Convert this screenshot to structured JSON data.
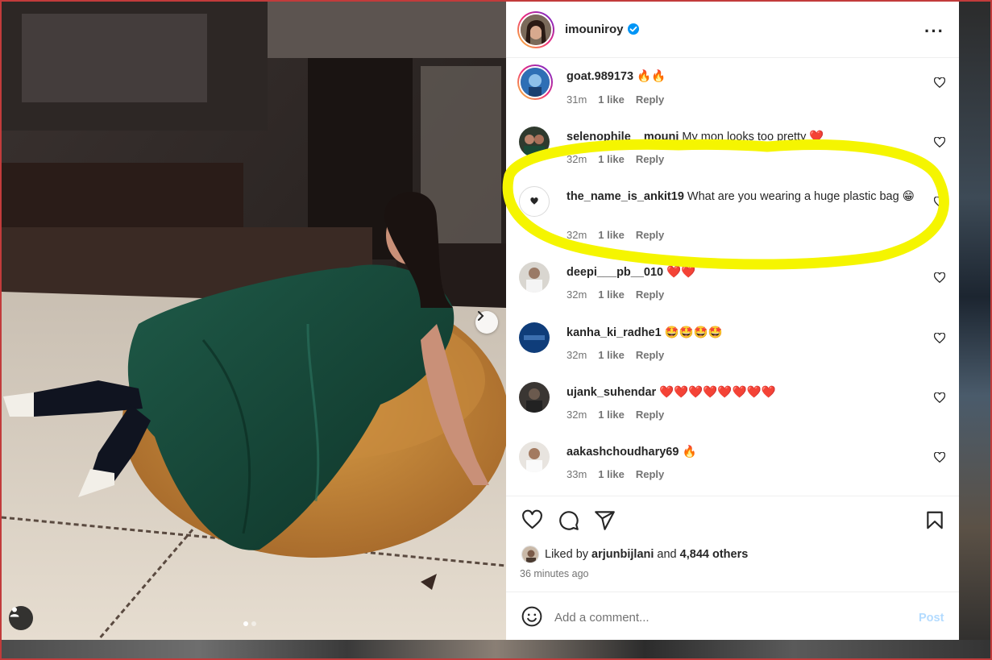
{
  "post": {
    "author": "imouniroy",
    "verified": true,
    "more_icon": "more-horizontal-icon"
  },
  "comments": [
    {
      "user": "goat.989173",
      "text": "🔥🔥",
      "time": "31m",
      "likes": "1 like",
      "reply": "Reply",
      "story_ring": true
    },
    {
      "user": "selenophile__mouni",
      "text": "My mon looks too pretty ❤️",
      "time": "32m",
      "likes": "1 like",
      "reply": "Reply",
      "story_ring": false
    },
    {
      "user": "the_name_is_ankit19",
      "text": "What are you wearing a huge plastic bag 😁",
      "time": "32m",
      "likes": "1 like",
      "reply": "Reply",
      "story_ring": false
    },
    {
      "user": "deepi___pb__010",
      "text": "❤️❤️",
      "time": "32m",
      "likes": "1 like",
      "reply": "Reply",
      "story_ring": false
    },
    {
      "user": "kanha_ki_radhe1",
      "text": "🤩🤩🤩🤩",
      "time": "32m",
      "likes": "1 like",
      "reply": "Reply",
      "story_ring": false
    },
    {
      "user": "ujank_suhendar",
      "text": "❤️❤️❤️❤️❤️❤️❤️❤️",
      "time": "32m",
      "likes": "1 like",
      "reply": "Reply",
      "story_ring": false
    },
    {
      "user": "aakashchoudhary69",
      "text": "🔥",
      "time": "33m",
      "likes": "1 like",
      "reply": "Reply",
      "story_ring": false
    }
  ],
  "likes": {
    "prefix": "Liked by",
    "user": "arjunbijlani",
    "conjunction": "and",
    "others": "4,844 others"
  },
  "time_ago": "36 minutes ago",
  "comment_box": {
    "placeholder": "Add a comment...",
    "post_label": "Post"
  },
  "carousel": {
    "total": 2,
    "current": 1
  },
  "colors": {
    "highlight": "#f5f500",
    "muted": "#737373",
    "post_disabled": "#b3dbff",
    "heart_red": "#e0245e"
  }
}
